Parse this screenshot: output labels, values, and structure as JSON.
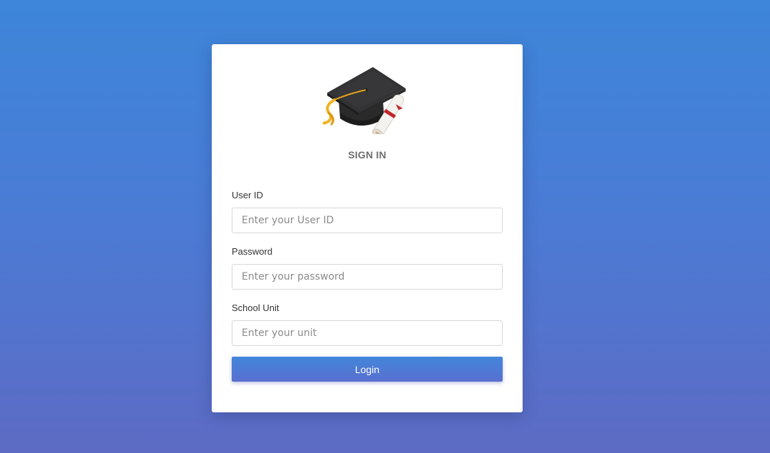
{
  "app": {
    "accent_color": "#4a7cd6",
    "logo_icon": "graduation-cap-diploma-icon"
  },
  "login": {
    "title": "SIGN IN",
    "fields": [
      {
        "label": "User ID",
        "placeholder": "Enter your User ID",
        "value": ""
      },
      {
        "label": "Password",
        "placeholder": "Enter your password",
        "value": ""
      },
      {
        "label": "School Unit",
        "placeholder": "Enter your unit",
        "value": ""
      }
    ],
    "submit_label": "Login"
  }
}
